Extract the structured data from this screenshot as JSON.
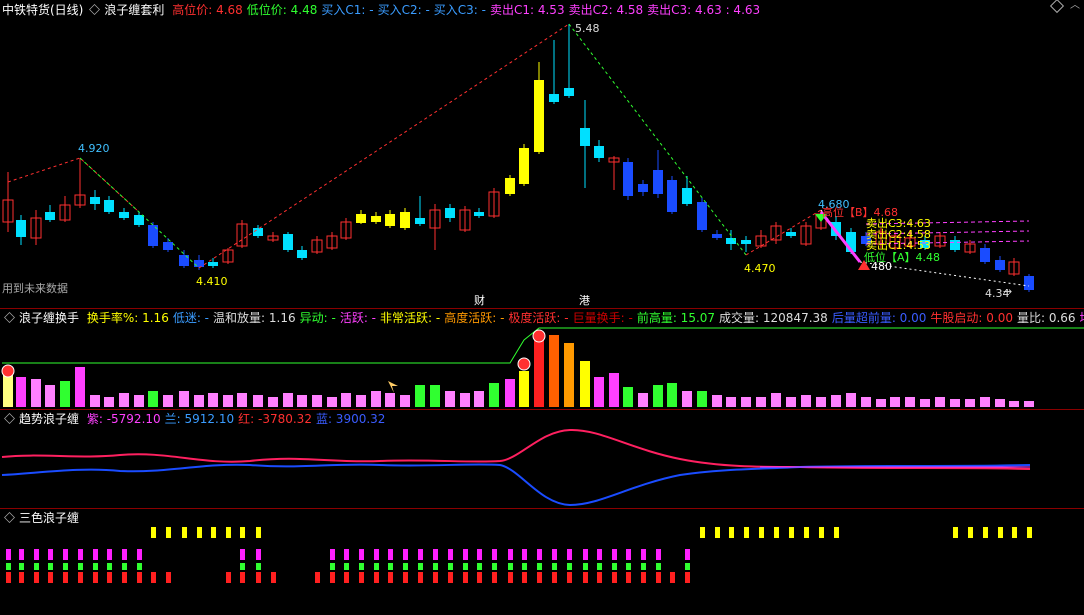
{
  "main": {
    "stock_title": "中铁特货(日线)",
    "indicator": "浪子缠套利",
    "items": [
      {
        "text": "高位价: 4.68",
        "color": "#ff3030"
      },
      {
        "text": "低位价: 4.48",
        "color": "#30ff30"
      },
      {
        "text": "买入C1: -",
        "color": "#3a9cff"
      },
      {
        "text": "买入C2: -",
        "color": "#3a9cff"
      },
      {
        "text": "买入C3: -",
        "color": "#3a9cff"
      },
      {
        "text": "卖出C1: 4.53",
        "color": "#ff40ff"
      },
      {
        "text": "卖出C2: 4.58",
        "color": "#ff40ff"
      },
      {
        "text": "卖出C3: 4.63 : 4.63",
        "color": "#ff40ff"
      }
    ],
    "labels": {
      "p4920": "4.920",
      "p548": "5.48",
      "p4410": "4.410",
      "p4470": "4.470",
      "p4680": "4.680",
      "p434": "4.34",
      "hi_tag": "高位【B】4.68",
      "sell3": "卖出C3:4.63",
      "sell2": "卖出C2:4.58",
      "sell1": "卖出C1:4.53",
      "lo_tag": "低位【A】4.48",
      "p480": "480",
      "future": "用到未来数据",
      "cai": "财",
      "gang": "港"
    }
  },
  "pane2": {
    "title": "浪子缠换手",
    "items": [
      {
        "text": "换手率%: 1.16",
        "color": "#ffff00"
      },
      {
        "text": "低迷: -",
        "color": "#3a9cff"
      },
      {
        "text": "温和放量: 1.16",
        "color": "#dddddd"
      },
      {
        "text": "异动: -",
        "color": "#30ff30"
      },
      {
        "text": "活跃: -",
        "color": "#ff40ff"
      },
      {
        "text": "非常活跃: -",
        "color": "#ffff00"
      },
      {
        "text": "高度活跃: -",
        "color": "#ff9900"
      },
      {
        "text": "极度活跃: -",
        "color": "#ff3030"
      },
      {
        "text": "巨量换手: -",
        "color": "#cc0000"
      },
      {
        "text": "前高量: 15.07",
        "color": "#30ff30"
      },
      {
        "text": "成交量: 120847.38",
        "color": "#dddddd"
      },
      {
        "text": "后量超前量: 0.00",
        "color": "#3a5cff"
      },
      {
        "text": "牛股启动: 0.00",
        "color": "#ff3030"
      },
      {
        "text": "量比: 0.66",
        "color": "#dddddd"
      },
      {
        "text": "均量金叉",
        "color": "#ff40ff"
      }
    ]
  },
  "pane3": {
    "title": "趋势浪子缠",
    "items": [
      {
        "text": "紫: -5792.10",
        "color": "#ff40ff"
      },
      {
        "text": "兰: 5912.10",
        "color": "#3a9cff"
      },
      {
        "text": "红: -3780.32",
        "color": "#ff3030"
      },
      {
        "text": "蓝: 3900.32",
        "color": "#3a5cff"
      }
    ]
  },
  "pane4": {
    "title": "三色浪子缠"
  },
  "colors": {
    "up": "#ff3030",
    "down": "#00e0ff",
    "blue": "#1a4cff",
    "yellow": "#ffff00",
    "border": "#8a0000"
  },
  "icons": {
    "settings": "diamond-icon",
    "scroll": "arrow-right-icon"
  }
}
